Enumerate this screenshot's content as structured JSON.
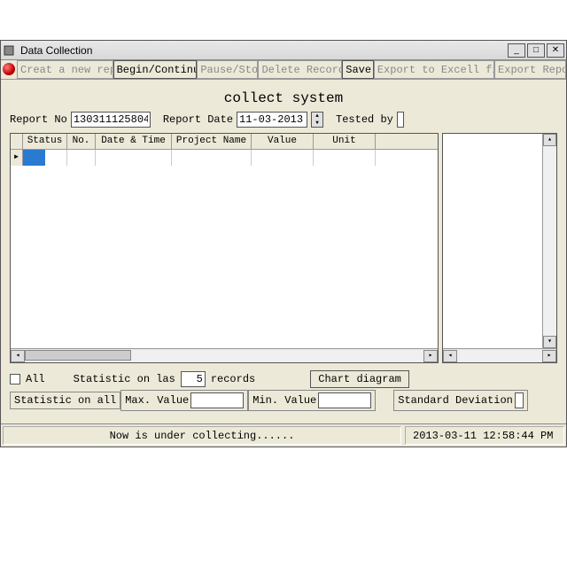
{
  "window": {
    "title": "Data Collection"
  },
  "toolbar": {
    "create": "Creat a new repor",
    "begin": "Begin/Continue",
    "pause": "Pause/Stop",
    "delete": "Delete Records",
    "save": "Save",
    "export_excel": "Export to Excell file",
    "export_report": "Export Repor"
  },
  "heading": "collect system",
  "form": {
    "report_no_label": "Report No",
    "report_no": "130311125804",
    "report_date_label": "Report Date",
    "report_date": "11-03-2013",
    "tested_by_label": "Tested by",
    "tested_by": ""
  },
  "columns": {
    "status": "Status",
    "no": "No.",
    "datetime": "Date & Time",
    "project": "Project Name",
    "value": "Value",
    "unit": "Unit"
  },
  "stats": {
    "all_label": "All",
    "last_label_pre": "Statistic on las",
    "last_n": "5",
    "last_label_post": "records",
    "chart_btn": "Chart diagram",
    "on_all": "Statistic on all",
    "max_label": "Max. Value",
    "max_val": "",
    "min_label": "Min. Value",
    "min_val": "",
    "std_label": "Standard Deviation",
    "std_val": ""
  },
  "status": {
    "message": "Now is under collecting......",
    "datetime": "2013-03-11 12:58:44 PM"
  }
}
